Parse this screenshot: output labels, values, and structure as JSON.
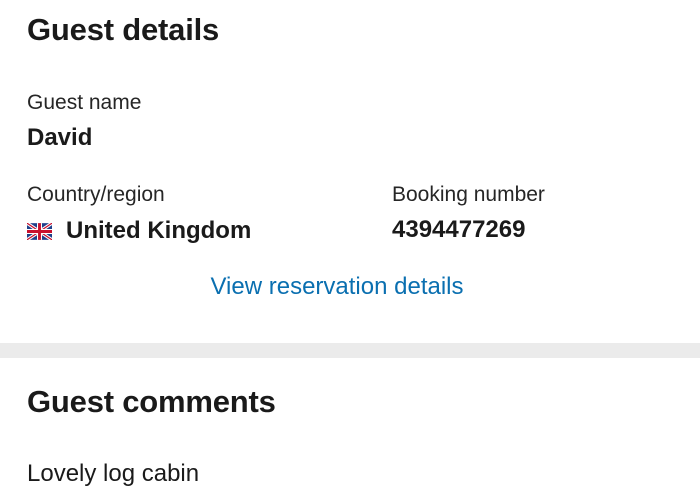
{
  "guest_details": {
    "heading": "Guest details",
    "guest_name_label": "Guest name",
    "guest_name": "David",
    "country_label": "Country/region",
    "country": "United Kingdom",
    "country_flag_icon": "uk-flag-icon",
    "booking_number_label": "Booking number",
    "booking_number": "4394477269",
    "view_reservation_link": "View reservation details"
  },
  "guest_comments": {
    "heading": "Guest comments",
    "comment": "Lovely log cabin"
  },
  "colors": {
    "link": "#0a6fb0",
    "divider": "#ebebeb",
    "text": "#1a1a1a"
  }
}
